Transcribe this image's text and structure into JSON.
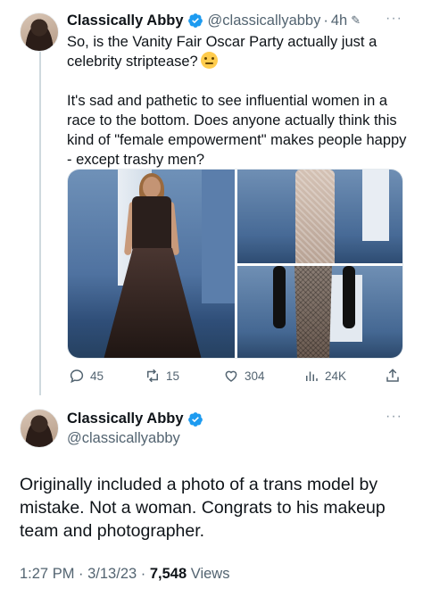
{
  "colors": {
    "text": "#0f1419",
    "secondary": "#536471",
    "verified": "#1d9bf0",
    "thread_line": "#cfd9de"
  },
  "tweet1": {
    "name": "Classically Abby",
    "handle": "@classicallyabby",
    "separator": "·",
    "time": "4h",
    "edited_icon": "pencil-icon",
    "more_icon": "···",
    "line1": "So, is the Vanity Fair Oscar Party actually just a celebrity striptease?",
    "emoji": "thinking-face",
    "line2": "It's sad and pathetic to see influential women in a race to the bottom. Does anyone actually think this kind of \"female empowerment\" makes people happy - except trashy men?",
    "actions": {
      "replies": "45",
      "retweets": "15",
      "likes": "304",
      "views": "24K"
    }
  },
  "tweet2": {
    "name": "Classically Abby",
    "handle": "@classicallyabby",
    "more_icon": "···",
    "body": "Originally included a photo of a trans model by mistake. Not a woman. Congrats to his makeup team and photographer.",
    "time": "1:27 PM",
    "sep": " · ",
    "date": "3/13/23",
    "sep2": " · ",
    "views_count": "7,548",
    "views_label": " Views"
  }
}
